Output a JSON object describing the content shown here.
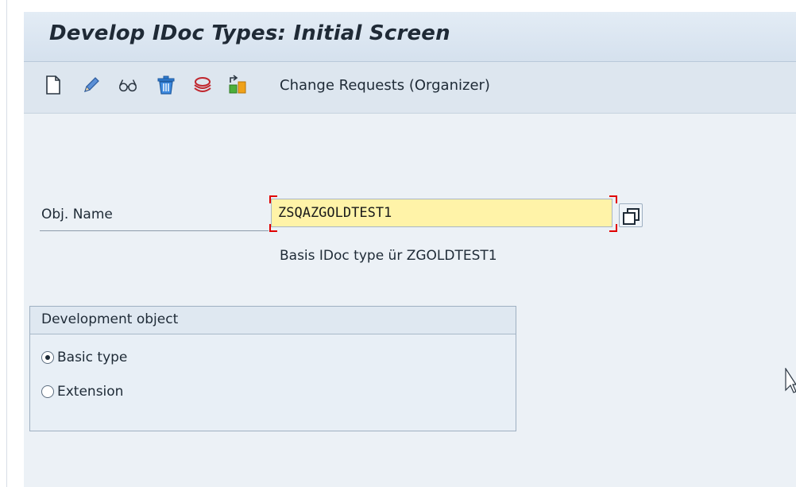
{
  "window": {
    "title": "Develop IDoc Types: Initial Screen"
  },
  "toolbar": {
    "icons": [
      "create-icon",
      "change-icon",
      "display-icon",
      "delete-icon",
      "where-used-icon",
      "copy-icon"
    ],
    "change_requests_label": "Change Requests (Organizer)"
  },
  "form": {
    "obj_name_label": "Obj. Name",
    "obj_name_value": "ZSQAZGOLDTEST1",
    "description": "Basis IDoc type ür ZGOLDTEST1",
    "input_color": "#fff3a8",
    "required_marker_color": "#e00000"
  },
  "development_object": {
    "title": "Development object",
    "options": [
      {
        "label": "Basic type",
        "selected": true
      },
      {
        "label": "Extension",
        "selected": false
      }
    ]
  },
  "colors": {
    "title_bar": "#d5e1ee",
    "toolbar": "#dde6ef",
    "content_bg": "#ecf1f6"
  }
}
